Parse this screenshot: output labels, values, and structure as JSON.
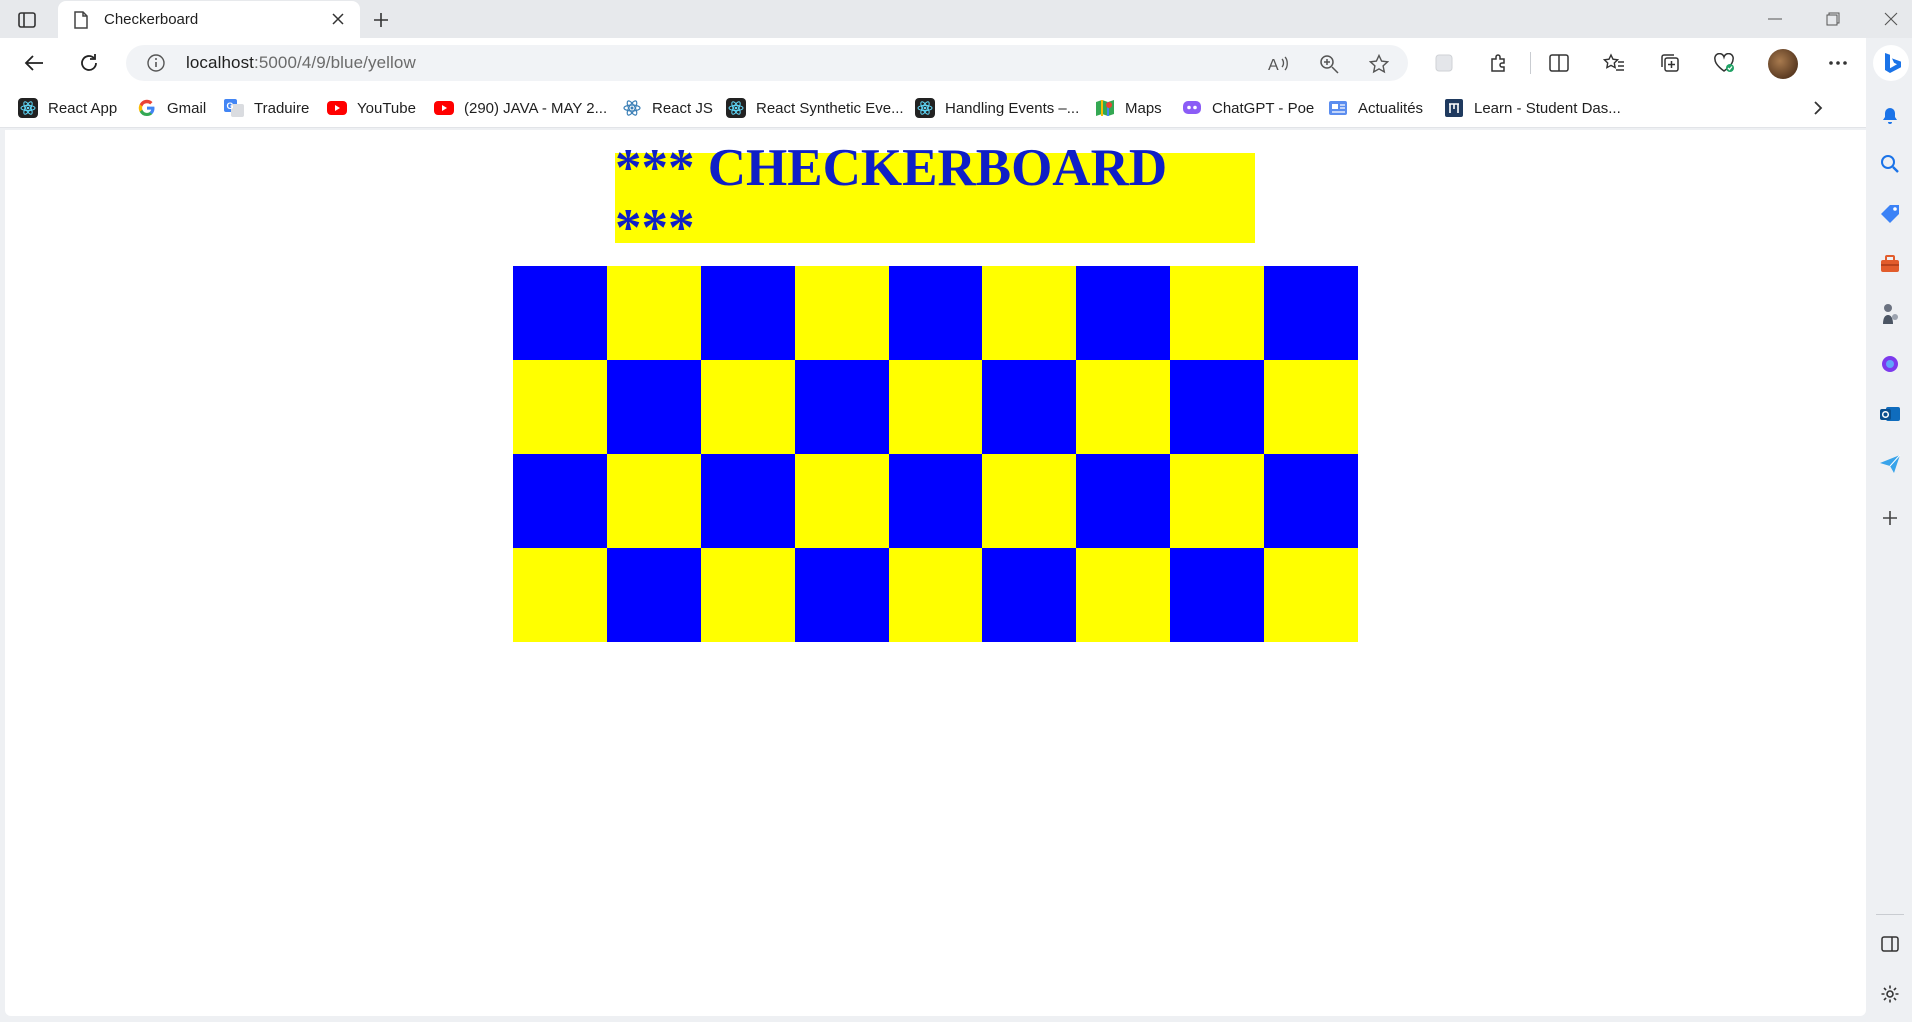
{
  "browser": {
    "tab": {
      "title": "Checkerboard"
    },
    "address_bar": {
      "host": "localhost",
      "path": ":5000/4/9/blue/yellow"
    },
    "bookmarks": [
      {
        "label": "React App",
        "icon": "react-icon"
      },
      {
        "label": "Gmail",
        "icon": "google-icon"
      },
      {
        "label": "Traduire",
        "icon": "translate-icon"
      },
      {
        "label": "YouTube",
        "icon": "youtube-icon"
      },
      {
        "label": "(290) JAVA - MAY 2...",
        "icon": "youtube-icon"
      },
      {
        "label": "React JS",
        "icon": "react-icon"
      },
      {
        "label": "React Synthetic Eve...",
        "icon": "react-icon"
      },
      {
        "label": "Handling Events –...",
        "icon": "react-icon"
      },
      {
        "label": "Maps",
        "icon": "maps-icon"
      },
      {
        "label": "ChatGPT - Poe",
        "icon": "poe-icon"
      },
      {
        "label": "Actualités",
        "icon": "news-icon"
      },
      {
        "label": "Learn - Student Das...",
        "icon": "learn-icon"
      }
    ]
  },
  "page": {
    "heading": "*** CHECKERBOARD ***",
    "board": {
      "rows": 4,
      "cols": 9,
      "color_a": "#0000ff",
      "color_b": "#ffff00"
    },
    "heading_bg": "#ffff00",
    "heading_color": "#0f1fc6"
  }
}
